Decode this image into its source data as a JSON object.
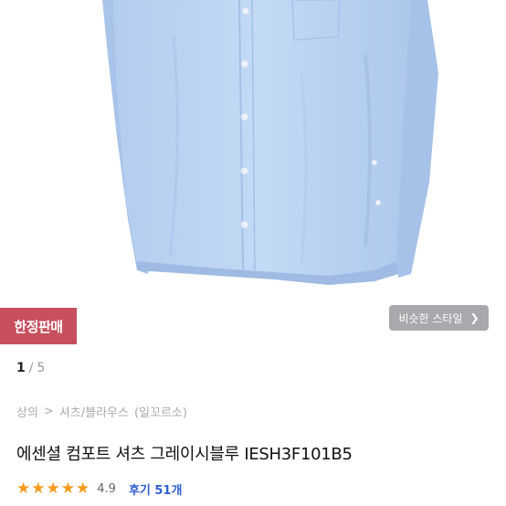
{
  "product": {
    "badge": "한정판매",
    "similar_style_label": "비슷한 스타일",
    "similar_style_chevron": "❯",
    "pager_current": "1",
    "pager_sep": "/",
    "pager_total": "5",
    "breadcrumb": [
      "상의",
      "셔츠/블라우스",
      "(일꼬르소)"
    ],
    "breadcrumb_sep": ">",
    "title": "에센셜 컴포트 셔츠 그레이시블루 IESH3F101B5",
    "rating_score": "4.9",
    "reviews_label": "후기 51개",
    "stars": 5
  },
  "colors": {
    "badge_bg": "#c8505e",
    "shirt": "#bcd5f3",
    "star": "#f59a1b",
    "review_link": "#2f5fd0"
  },
  "icons": {
    "star": "★",
    "chevron": "chevron-right-icon"
  }
}
